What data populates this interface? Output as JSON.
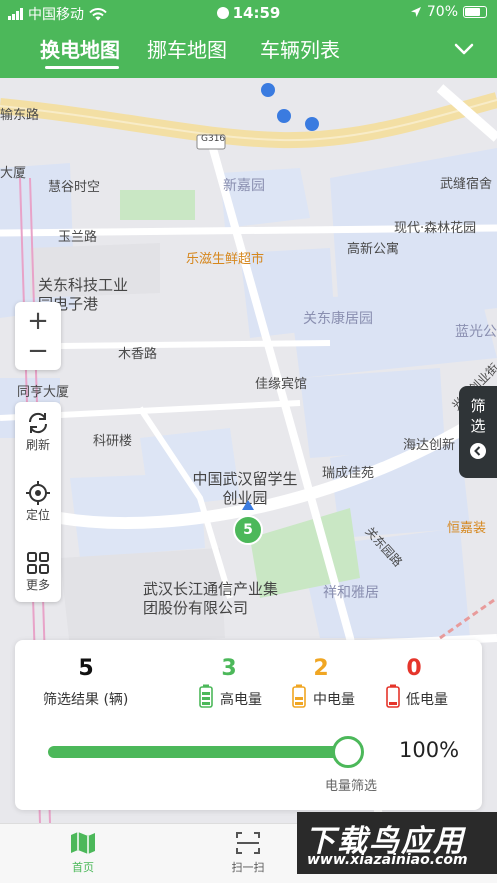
{
  "status_bar": {
    "carrier": "中国移动",
    "time": "14:59",
    "battery": "70%"
  },
  "header": {
    "tabs": [
      {
        "label": "换电地图",
        "active": true
      },
      {
        "label": "挪车地图",
        "active": false
      },
      {
        "label": "车辆列表",
        "active": false
      }
    ]
  },
  "map": {
    "roads": [
      "输东路",
      "玉兰路",
      "木香路",
      "光谷创业街",
      "关东园路",
      "G316"
    ],
    "pois": [
      "慧谷时空",
      "新嘉园",
      "武缝宿舍",
      "乐滋生鲜超市",
      "现代·森林花园",
      "高新公寓",
      "关东科技工业园电子港",
      "关东康居园",
      "蓝光公",
      "同亨大厦",
      "佳缘宾馆",
      "科研楼",
      "海达创新",
      "瑞成佳苑",
      "中国武汉留学生创业园",
      "恒嘉装",
      "武汉长江通信产业集团股份有限公司",
      "祥和雅居",
      "大厦"
    ],
    "marker_count": "5"
  },
  "controls": {
    "zoom_in": "+",
    "zoom_out": "−",
    "refresh_label": "刷新",
    "locate_label": "定位",
    "more_label": "更多",
    "filter_label": "筛选"
  },
  "stats": {
    "total": {
      "value": "5",
      "label": "筛选结果 (辆)"
    },
    "high": {
      "value": "3",
      "label": "高电量",
      "color": "#4cb85a"
    },
    "mid": {
      "value": "2",
      "label": "中电量",
      "color": "#f0a623"
    },
    "low": {
      "value": "0",
      "label": "低电量",
      "color": "#e5352b"
    },
    "battery_filter": {
      "value": "100%",
      "label": "电量筛选",
      "level": 1.0
    }
  },
  "bottom_nav": [
    {
      "label": "首页",
      "active": true
    },
    {
      "label": "扫一扫",
      "active": false
    }
  ],
  "watermark": {
    "main": "下载鸟应用",
    "sub": "www.xiazainiao.com"
  },
  "colors": {
    "brand": "#4cb85a"
  }
}
